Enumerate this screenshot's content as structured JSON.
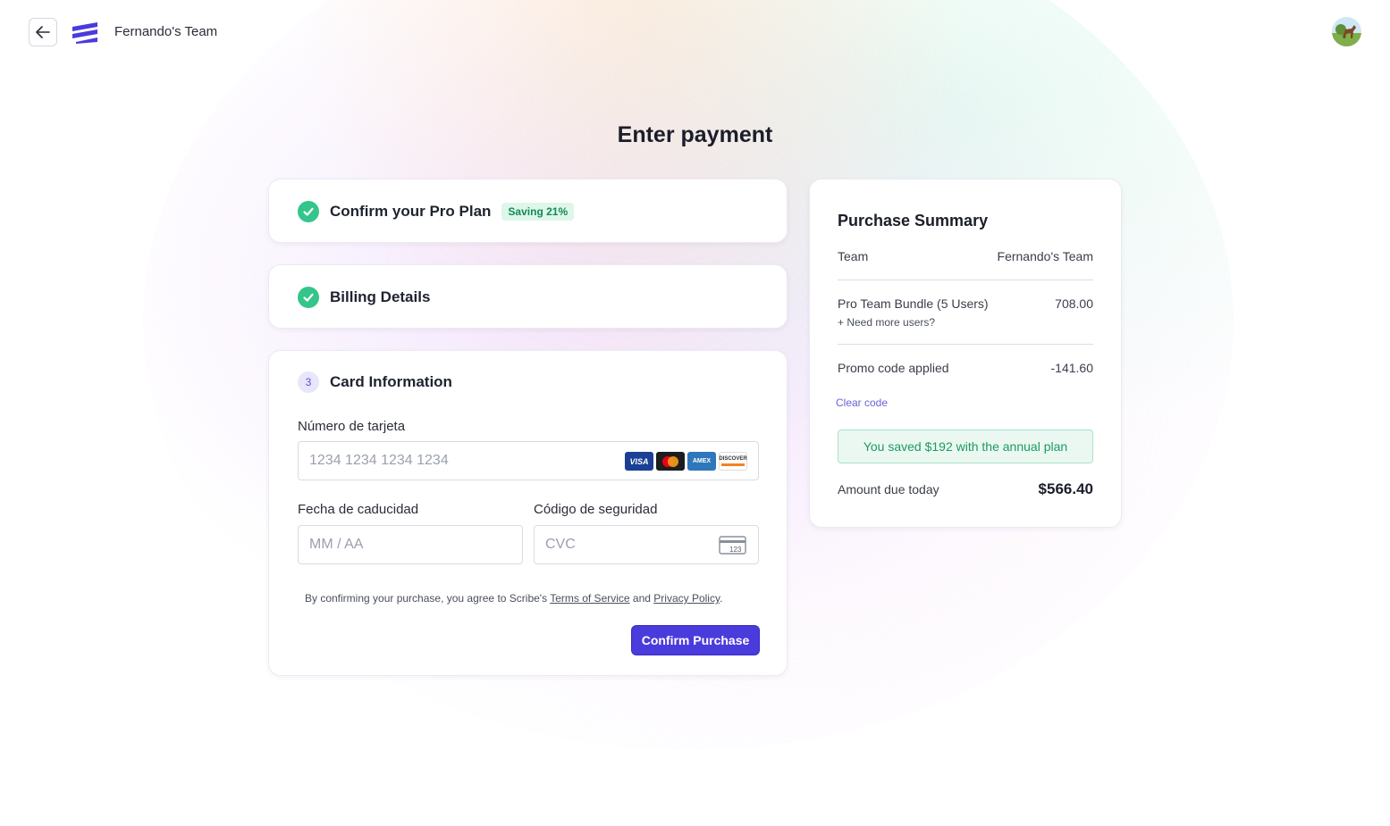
{
  "header": {
    "team_name": "Fernando's Team"
  },
  "page": {
    "title": "Enter payment"
  },
  "steps": {
    "plan": {
      "title": "Confirm your Pro Plan",
      "badge": "Saving 21%"
    },
    "billing": {
      "title": "Billing Details"
    },
    "card": {
      "number": "3",
      "title": "Card Information",
      "card_number_label": "Número de tarjeta",
      "card_number_placeholder": "1234 1234 1234 1234",
      "expiry_label": "Fecha de caducidad",
      "expiry_placeholder": "MM / AA",
      "cvc_label": "Código de seguridad",
      "cvc_placeholder": "CVC",
      "cvc_icon_text": "123",
      "card_brands": [
        "VISA",
        "MASTERCARD",
        "AMEX",
        "DISCOVER"
      ]
    }
  },
  "legal": {
    "prefix": "By confirming your purchase, you agree to Scribe's ",
    "terms": "Terms of Service",
    "and": " and ",
    "privacy": "Privacy Policy",
    "suffix": "."
  },
  "actions": {
    "confirm_label": "Confirm Purchase"
  },
  "summary": {
    "title": "Purchase Summary",
    "team_label": "Team",
    "team_value": "Fernando's Team",
    "bundle_label": "Pro Team Bundle (5 Users)",
    "bundle_value": "708.00",
    "more_users": "+ Need more users?",
    "promo_label": "Promo code applied",
    "promo_value": "-141.60",
    "clear_code": "Clear code",
    "saved_text": "You saved $192 with the annual plan",
    "amount_label": "Amount due today",
    "amount_value": "$566.40"
  },
  "colors": {
    "accent": "#4a3bdc",
    "success": "#34c58b",
    "saved_text": "#1d9a62"
  }
}
